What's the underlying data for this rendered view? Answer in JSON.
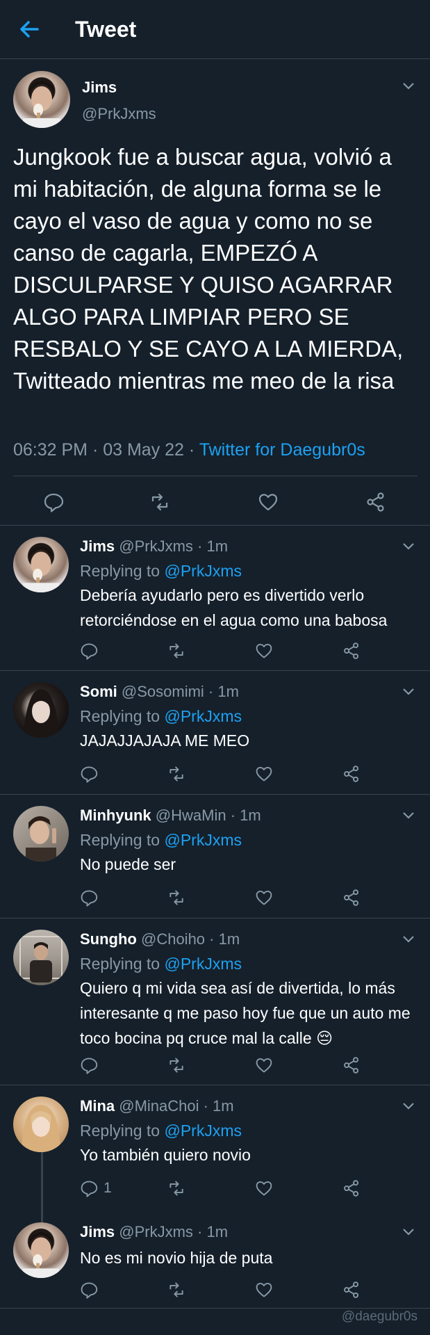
{
  "header": {
    "title": "Tweet"
  },
  "main_tweet": {
    "name": "Jims",
    "handle": "@PrkJxms",
    "text": "Jungkook fue a buscar agua, volvió a mi habitación, de alguna forma se le cayo el vaso de agua y como no se canso de cagarla, EMPEZÓ A DISCULPARSE Y QUISO AGARRAR ALGO PARA LIMPIAR PERO SE RESBALO Y SE CAYO A LA MIERDA, Twitteado mientras me meo de la risa",
    "time_date": "06:32 PM · 03 May 22 · ",
    "source": "Twitter for Daegubr0s"
  },
  "replies": [
    {
      "name": "Jims",
      "meta": " @PrkJxms · 1m",
      "replying_prefix": "Replying to ",
      "replying_to": "@PrkJxms",
      "text": "Debería ayudarlo pero es divertido verlo retorciéndose en el agua como una babosa",
      "reply_count": ""
    },
    {
      "name": "Somi",
      "meta": " @Sosomimi · 1m",
      "replying_prefix": "Replying to ",
      "replying_to": "@PrkJxms",
      "text": "JAJAJJAJAJA ME MEO",
      "reply_count": ""
    },
    {
      "name": "Minhyunk",
      "meta": " @HwaMin · 1m",
      "replying_prefix": "Replying to ",
      "replying_to": "@PrkJxms",
      "text": "No puede ser",
      "reply_count": ""
    },
    {
      "name": "Sungho",
      "meta": " @Choiho · 1m",
      "replying_prefix": "Replying to ",
      "replying_to": "@PrkJxms",
      "text": "Quiero q mi vida sea así de divertida, lo más interesante q me paso hoy fue que un auto me toco bocina pq cruce mal la calle 😔",
      "reply_count": ""
    },
    {
      "name": "Mina",
      "meta": " @MinaChoi · 1m",
      "replying_prefix": "Replying to ",
      "replying_to": "@PrkJxms",
      "text": "Yo también quiero novio",
      "reply_count": "1"
    },
    {
      "name": "Jims",
      "meta": " @PrkJxms · 1m",
      "replying_prefix": "",
      "replying_to": "",
      "text": "No es mi novio hija de puta",
      "reply_count": ""
    }
  ],
  "watermark": "@daegubr0s",
  "colors": {
    "background": "#15202b",
    "accent": "#1da1f2",
    "muted": "#8899a6",
    "border": "#38444d"
  },
  "icons": [
    "back-arrow-icon",
    "chevron-down-icon",
    "reply-icon",
    "retweet-icon",
    "like-icon",
    "share-icon"
  ]
}
